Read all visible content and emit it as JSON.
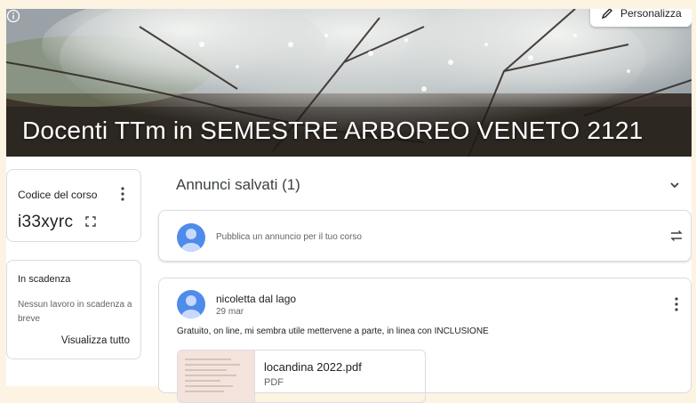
{
  "banner": {
    "title": "Docenti TTm in SEMESTRE ARBOREO VENETO 2121",
    "customize_label": "Personalizza"
  },
  "class_code": {
    "label": "Codice del corso",
    "value": "i33xyrc"
  },
  "upcoming": {
    "title": "In scadenza",
    "empty_text": "Nessun lavoro in scadenza a breve",
    "view_all_label": "Visualizza tutto"
  },
  "saved_announcements": {
    "title": "Annunci salvati (1)"
  },
  "compose": {
    "placeholder": "Pubblica un annuncio per il tuo corso"
  },
  "announcement": {
    "author": "nicoletta dal lago",
    "date": "29 mar",
    "text": "Gratuito, on line, mi sembra utile mettervene a parte, in linea con INCLUSIONE",
    "attachment": {
      "name": "locandina 2022.pdf",
      "type": "PDF"
    }
  },
  "colors": {
    "avatar": "#4f8bea",
    "frame": "#fdf3e2",
    "border": "#dadce0"
  },
  "icons": [
    "pencil-icon",
    "info-icon",
    "more-vert-icon",
    "fullscreen-icon",
    "chevron-down-icon",
    "repost-icon"
  ]
}
